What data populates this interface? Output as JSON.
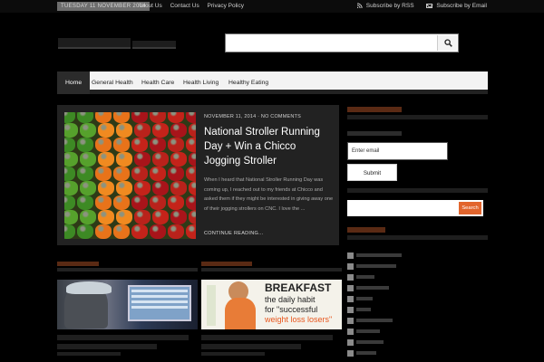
{
  "topbar": {
    "date": "TUESDAY 11 NOVEMBER 2014",
    "links": [
      "About Us",
      "Contact Us",
      "Privacy Policy"
    ],
    "subscribe_rss": "Subscribe by RSS",
    "subscribe_email": "Subscribe by Email"
  },
  "header": {
    "search_placeholder": "",
    "icons": {
      "search": "search-icon",
      "rss": "rss-icon",
      "email": "mail-icon"
    }
  },
  "nav": {
    "items": [
      "Home",
      "General Health",
      "Health Care",
      "Health Living",
      "Healthy Eating"
    ],
    "active": "Home"
  },
  "featured": {
    "meta": "NOVEMBER 11, 2014 · NO COMMENTS",
    "title": "National Stroller Running Day + Win a Chicco Jogging Stroller",
    "excerpt": "When I heard that National Stroller Running Day was coming up, I reached out to my friends at Chicco and asked them if they might be interested in giving away one of their jogging strollers on CNC. I love the ...",
    "read_more": "CONTINUE READING..."
  },
  "cards": {
    "right_ad_line1": "BREAKFAST",
    "right_ad_line2": "the daily habit",
    "right_ad_line3": "for \"successful",
    "right_ad_line4": "weight loss losers\""
  },
  "sidebar": {
    "email_placeholder": "Enter email",
    "submit_label": "Submit",
    "search_button": "Search"
  },
  "colors": {
    "accent": "#cc5a27",
    "search_button": "#e2652d",
    "nav_bg": "#f3f3f3"
  }
}
